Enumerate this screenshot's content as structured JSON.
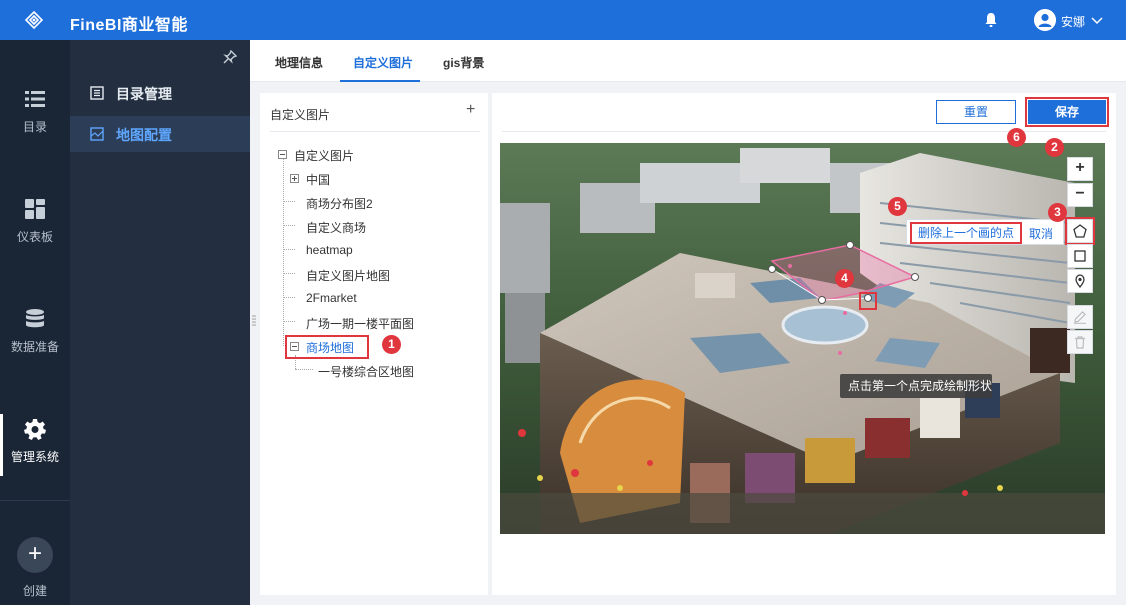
{
  "header": {
    "app_title": "FineBI商业智能",
    "user_name": "安娜",
    "icons": {
      "logo": "logo-icon",
      "bell": "bell-icon",
      "avatar": "user-avatar-icon",
      "chevron": "chevron-down-icon"
    }
  },
  "left_nav": {
    "items": [
      {
        "label": "目录",
        "icon": "list-icon"
      },
      {
        "label": "仪表板",
        "icon": "dashboard-icon"
      },
      {
        "label": "数据准备",
        "icon": "database-icon"
      },
      {
        "label": "管理系统",
        "icon": "gear-icon",
        "active": true
      }
    ],
    "create_label": "创建",
    "create_symbol": "+"
  },
  "sub_nav": {
    "items": [
      {
        "label": "目录管理",
        "icon": "catalog-icon"
      },
      {
        "label": "地图配置",
        "icon": "map-config-icon",
        "active": true
      }
    ]
  },
  "tabs": [
    {
      "label": "地理信息"
    },
    {
      "label": "自定义图片",
      "active": true
    },
    {
      "label": "gis背景"
    }
  ],
  "tree": {
    "title": "自定义图片",
    "add_symbol": "+",
    "root": "自定义图片",
    "nodes": [
      "中国",
      "商场分布图2",
      "自定义商场",
      "heatmap",
      "自定义图片地图",
      "2Fmarket",
      "广场一期一楼平面图",
      "商场地图"
    ],
    "child": "一号楼综合区地图",
    "selected": "商场地图"
  },
  "toolbar": {
    "reset_label": "重置",
    "save_label": "保存"
  },
  "map_tools": {
    "zoom_in": "+",
    "zoom_out": "−",
    "icons": [
      "zoom-in-icon",
      "zoom-out-icon",
      "polygon-icon",
      "rectangle-icon",
      "marker-pin-icon",
      "edit-icon",
      "trash-icon"
    ]
  },
  "drawing_hint": {
    "delete_last_label": "删除上一个画的点",
    "cancel_label": "取消",
    "tooltip": "点击第一个点完成绘制形状"
  },
  "annotations": [
    "1",
    "2",
    "3",
    "4",
    "5",
    "6"
  ],
  "colors": {
    "header": "#1f6fdb",
    "leftnav": "#1a2535",
    "subnav": "#232f40",
    "accent": "#1f6fdb",
    "annotation_red": "#e0363d"
  }
}
